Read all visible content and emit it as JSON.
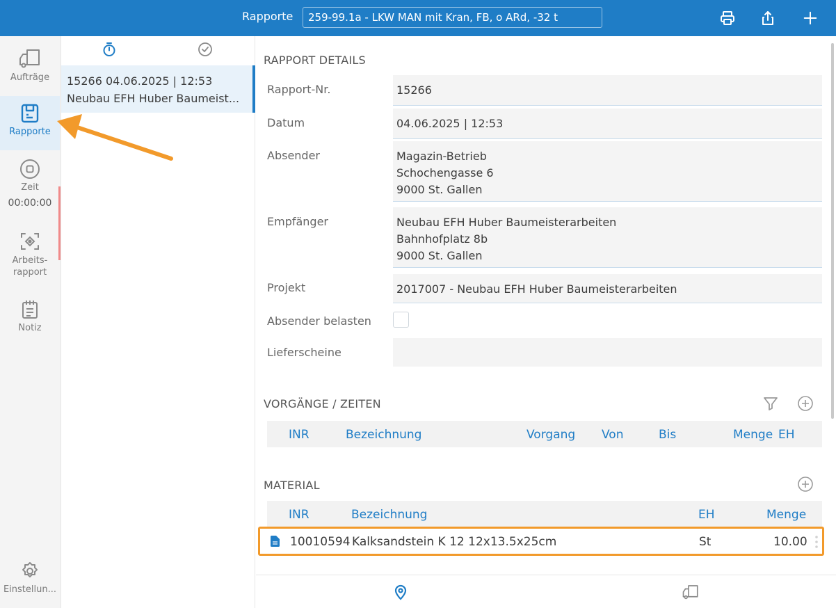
{
  "topbar": {
    "title": "Rapporte",
    "selected_vehicle": "259-99.1a - LKW MAN mit Kran, FB, o ARd, -32 t",
    "icons": [
      "printer-icon",
      "share-icon",
      "plus-icon"
    ],
    "color": "#1f7dc6"
  },
  "nav": {
    "items": [
      {
        "label": "Aufträge",
        "icon": "truck-icon"
      },
      {
        "label": "Rapporte",
        "icon": "report-icon",
        "active": true
      },
      {
        "label": "Zeit",
        "icon": "stop-icon"
      },
      {
        "label": "Arbeits-\nrapport",
        "icon": "scan-icon"
      },
      {
        "label": "Notiz",
        "icon": "notepad-icon"
      }
    ],
    "time_value": "00:00:00",
    "settings_label": "Einstellun..."
  },
  "list": {
    "tab_icons": [
      "stopwatch-icon",
      "check-circle-icon"
    ],
    "item": {
      "line1": "15266  04.06.2025 | 12:53",
      "line2": "Neubau EFH Huber Baumeist..."
    }
  },
  "details": {
    "section_title": "RAPPORT DETAILS",
    "fields": {
      "rapport_nr": {
        "label": "Rapport-Nr.",
        "value": "15266"
      },
      "datum": {
        "label": "Datum",
        "value": "04.06.2025 | 12:53"
      },
      "absender": {
        "label": "Absender",
        "value": "Magazin-Betrieb\nSchochengasse 6\n9000 St. Gallen"
      },
      "empfaenger": {
        "label": "Empfänger",
        "value": "Neubau EFH Huber Baumeisterarbeiten\nBahnhofplatz 8b\n9000 St. Gallen"
      },
      "projekt": {
        "label": "Projekt",
        "value": "2017007 - Neubau EFH Huber Baumeisterarbeiten"
      },
      "absender_belasten": {
        "label": "Absender belasten",
        "checked": false
      },
      "lieferscheine": {
        "label": "Lieferscheine",
        "value": ""
      }
    }
  },
  "vorgaenge": {
    "title": "VORGÄNGE / ZEITEN",
    "columns": {
      "inr": "INR",
      "bezeichnung": "Bezeichnung",
      "vorgang": "Vorgang",
      "von": "Von",
      "bis": "Bis",
      "menge": "Menge",
      "eh": "EH"
    }
  },
  "material": {
    "title": "MATERIAL",
    "columns": {
      "inr": "INR",
      "bezeichnung": "Bezeichnung",
      "eh": "EH",
      "menge": "Menge"
    },
    "rows": [
      {
        "inr": "10010594",
        "bezeichnung": "Kalksandstein K 12 12x13.5x25cm",
        "eh": "St",
        "menge": "10.00"
      }
    ]
  },
  "bottombar": {
    "icons": [
      "location-pin-icon",
      "truck-icon"
    ]
  },
  "colors": {
    "accent": "#1f7dc6",
    "highlight": "#f29a2b",
    "time_stripe": "#f08a8a"
  }
}
